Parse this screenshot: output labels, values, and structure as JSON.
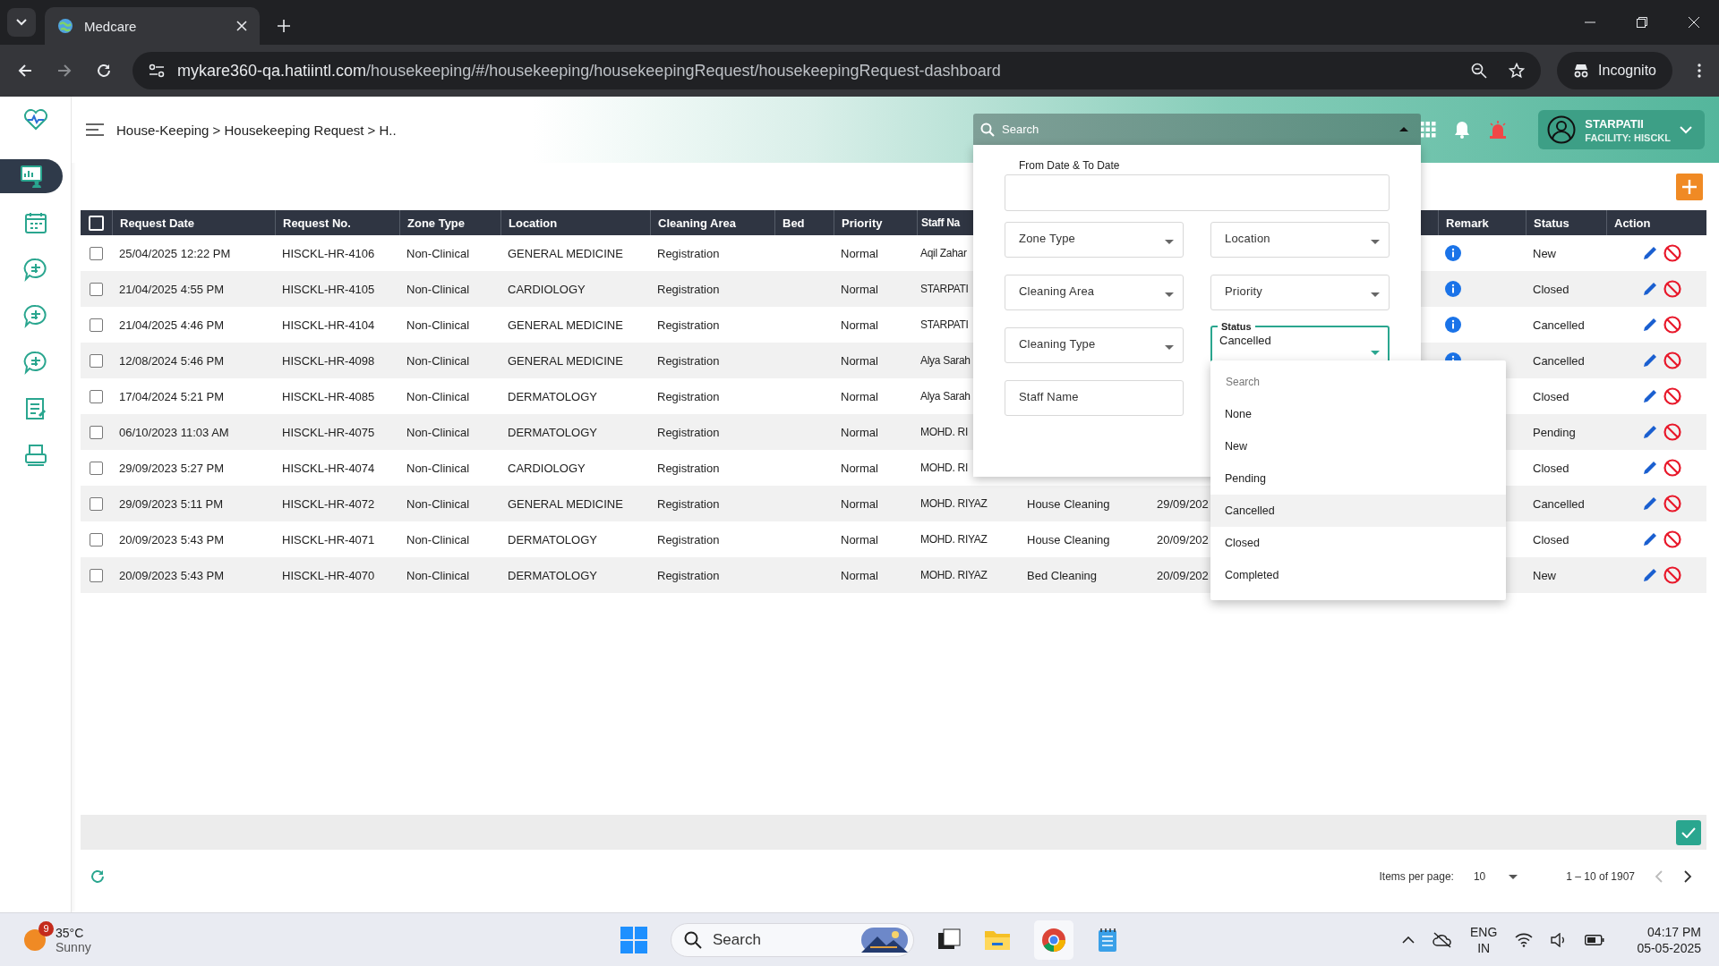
{
  "browser": {
    "tab_title": "Medcare",
    "url_host": "mykare360-qa.hatiintl.com",
    "url_path": "/housekeeping/#/housekeeping/housekeepingRequest/housekeepingRequest-dashboard",
    "profile": "Incognito"
  },
  "sidebar": {
    "items": [
      {
        "selected": true
      },
      {
        "selected": false
      },
      {
        "selected": false
      },
      {
        "selected": false
      },
      {
        "selected": false
      },
      {
        "selected": false
      },
      {
        "selected": false
      }
    ]
  },
  "header": {
    "breadcrumb": "House-Keeping > Housekeeping Request > H..",
    "user_name": "STARPATIl",
    "facility": "FACILITY: HISCKL"
  },
  "table": {
    "columns": [
      "Request Date",
      "Request No.",
      "Zone Type",
      "Location",
      "Cleaning Area",
      "Bed",
      "Priority",
      "Staff Na",
      "Remark",
      "Status",
      "Action"
    ],
    "all_checked": false,
    "rows": [
      {
        "checked": false,
        "date": "25/04/2025 12:22 PM",
        "number": "HISCKL-HR-4106",
        "zone": "Non-Clinical",
        "location": "GENERAL MEDICINE",
        "area": "Registration",
        "priority": "Normal",
        "staff": "Aqil Zahar",
        "remark": true,
        "status": "New"
      },
      {
        "checked": false,
        "date": "21/04/2025 4:55 PM",
        "number": "HISCKL-HR-4105",
        "zone": "Non-Clinical",
        "location": "CARDIOLOGY",
        "area": "Registration",
        "priority": "Normal",
        "staff": "STARPATI",
        "remark": true,
        "status": "Closed"
      },
      {
        "checked": false,
        "date": "21/04/2025 4:46 PM",
        "number": "HISCKL-HR-4104",
        "zone": "Non-Clinical",
        "location": "GENERAL MEDICINE",
        "area": "Registration",
        "priority": "Normal",
        "staff": "STARPATI",
        "remark": true,
        "status": "Cancelled"
      },
      {
        "checked": false,
        "date": "12/08/2024 5:46 PM",
        "number": "HISCKL-HR-4098",
        "zone": "Non-Clinical",
        "location": "GENERAL MEDICINE",
        "area": "Registration",
        "priority": "Normal",
        "staff": "Alya Sarah",
        "remark": true,
        "status": "Cancelled"
      },
      {
        "checked": false,
        "date": "17/04/2024 5:21 PM",
        "number": "HISCKL-HR-4085",
        "zone": "Non-Clinical",
        "location": "DERMATOLOGY",
        "area": "Registration",
        "priority": "Normal",
        "staff": "Alya Sarah",
        "status": "Closed"
      },
      {
        "checked": false,
        "date": "06/10/2023 11:03 AM",
        "number": "HISCKL-HR-4075",
        "zone": "Non-Clinical",
        "location": "DERMATOLOGY",
        "area": "Registration",
        "priority": "Normal",
        "staff": "MOHD. RI",
        "status": "Pending"
      },
      {
        "checked": false,
        "date": "29/09/2023 5:27 PM",
        "number": "HISCKL-HR-4074",
        "zone": "Non-Clinical",
        "location": "CARDIOLOGY",
        "area": "Registration",
        "priority": "Normal",
        "staff": "MOHD. RI",
        "status": "Closed"
      },
      {
        "checked": false,
        "date": "29/09/2023 5:11 PM",
        "number": "HISCKL-HR-4072",
        "zone": "Non-Clinical",
        "location": "GENERAL MEDICINE",
        "area": "Registration",
        "priority": "Normal",
        "staff": "MOHD. RIYAZ",
        "column_9": "House Cleaning",
        "column_10": "29/09/202",
        "status": "Cancelled"
      },
      {
        "checked": false,
        "date": "20/09/2023 5:43 PM",
        "number": "HISCKL-HR-4071",
        "zone": "Non-Clinical",
        "location": "DERMATOLOGY",
        "area": "Registration",
        "priority": "Normal",
        "staff": "MOHD. RIYAZ",
        "column_9": "House Cleaning",
        "column_10": "20/09/202",
        "status": "Closed"
      },
      {
        "checked": false,
        "date": "20/09/2023 5:43 PM",
        "number": "HISCKL-HR-4070",
        "zone": "Non-Clinical",
        "location": "DERMATOLOGY",
        "area": "Registration",
        "priority": "Normal",
        "staff": "MOHD. RIYAZ",
        "column_9": "Bed Cleaning",
        "column_10": "20/09/202",
        "status": "New"
      }
    ]
  },
  "filter_panel": {
    "search": "Search",
    "expanded": true,
    "date_label": "From Date & To Date",
    "selects": [
      {
        "label": "Zone Type"
      },
      {
        "label": "Location"
      },
      {
        "label": "Cleaning Area"
      },
      {
        "label": "Priority"
      },
      {
        "label": "Cleaning Type"
      },
      {
        "label": "Status",
        "value": "Cancelled",
        "focused": true
      },
      {
        "label": "Staff Name",
        "kind": "text"
      }
    ],
    "status_dropdown": {
      "search_placeholder": "Search",
      "options": [
        {
          "label": "None",
          "selected": false
        },
        {
          "label": "New",
          "selected": false
        },
        {
          "label": "Pending",
          "selected": false
        },
        {
          "label": "Cancelled",
          "selected": true
        },
        {
          "label": "Closed",
          "selected": false
        },
        {
          "label": "Completed",
          "selected": false
        }
      ]
    }
  },
  "pagination": {
    "items_label": "Items per page:",
    "page_size": "10",
    "range": "1 – 10 of 1907"
  },
  "taskbar": {
    "temperature": "35°C",
    "weather": "Sunny",
    "weather_badge": "9",
    "search": "Search",
    "language": "ENG",
    "region": "IN",
    "time": "04:17 PM",
    "date": "05-05-2025"
  }
}
